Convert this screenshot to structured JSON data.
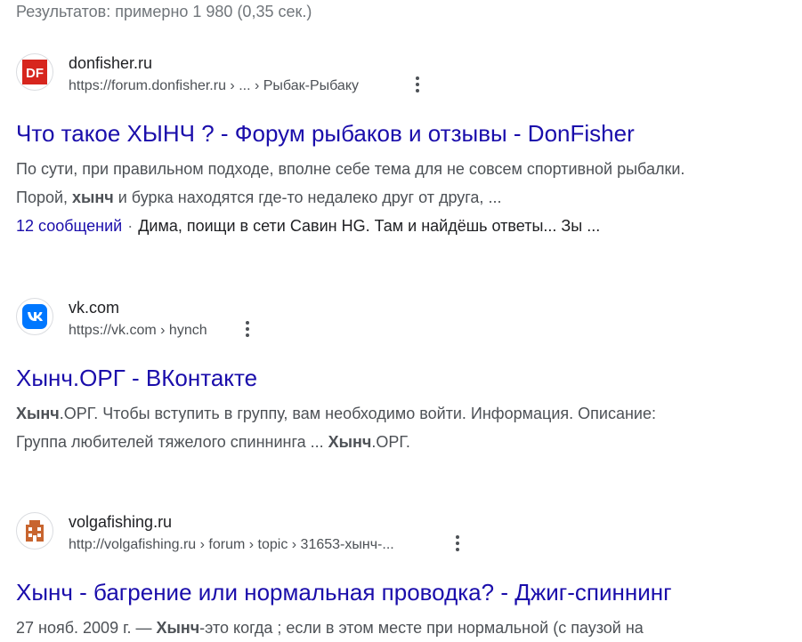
{
  "stats": "Результатов: примерно 1 980 (0,35 сек.)",
  "results": [
    {
      "site": "donfisher.ru",
      "url": "https://forum.donfisher.ru › ... › Рыбак-Рыбаку",
      "title": "Что такое ХЫНЧ ? - Форум рыбаков и отзывы - DonFisher",
      "snippet_l1": "По сути, при правильном подходе, вполне себе тема для не совсем спортивной рыбалки.",
      "snippet_l2_a": "Порой, ",
      "snippet_l2_b": "хынч",
      "snippet_l2_c": " и бурка находятся где-то недалеко друг от друга, ...",
      "sitelink": "12 сообщений",
      "sitelink_sep": "·",
      "sitelink_text": "Дима, поищи в сети Савин HG. Там и найдёшь ответы... Зы ...",
      "favicon_text": "DF",
      "favicon_color": "#d7261e"
    },
    {
      "site": "vk.com",
      "url": "https://vk.com › hynch",
      "title": "Хынч.ОРГ - ВКонтакте",
      "snippet_l1_a": "Хынч",
      "snippet_l1_b": ".ОРГ. Чтобы вступить в группу, вам необходимо войти. Информация. Описание:",
      "snippet_l2_a": "Группа любителей тяжелого спиннинга ... ",
      "snippet_l2_b": "Хынч",
      "snippet_l2_c": ".ОРГ.",
      "favicon_text": "VK",
      "favicon_color": "#0077ff"
    },
    {
      "site": "volgafishing.ru",
      "url": "http://volgafishing.ru › forum › topic › 31653-хынч-...",
      "title": "Хынч - багрение или нормальная проводка? - Джиг-спиннинг",
      "snippet_a": "27 нояб. 2009 г. — ",
      "snippet_b": "Хынч",
      "snippet_c": "-это когда ; если в этом месте при нормальной (с паузой на",
      "favicon_color": "#c8652f"
    }
  ],
  "colors": {
    "link": "#1a0dab",
    "text": "#4d5156",
    "muted": "#70757a"
  },
  "icons": [
    "donfisher-favicon-icon",
    "vk-favicon-icon",
    "volgafishing-favicon-icon",
    "more-options-icon"
  ]
}
